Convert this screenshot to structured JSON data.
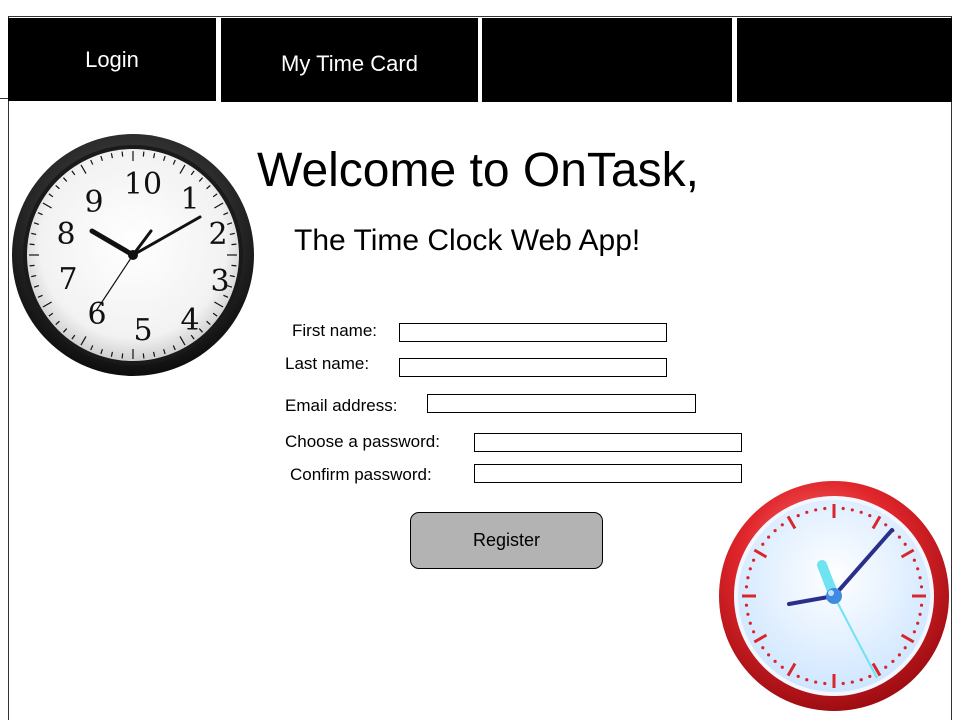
{
  "nav": {
    "tabs": [
      {
        "label": "Login"
      },
      {
        "label": "My Time Card"
      },
      {
        "label": ""
      },
      {
        "label": ""
      }
    ]
  },
  "header": {
    "title": "Welcome to OnTask,",
    "subtitle": "The Time Clock Web App!"
  },
  "form": {
    "first_name": {
      "label": "First name:",
      "value": ""
    },
    "last_name": {
      "label": "Last name:",
      "value": ""
    },
    "email": {
      "label": "Email address:",
      "value": ""
    },
    "password": {
      "label": "Choose a password:",
      "value": ""
    },
    "confirm_password": {
      "label": "Confirm password:",
      "value": ""
    },
    "register_label": "Register"
  },
  "icons": {
    "left_clock": "wall-clock-icon",
    "right_clock": "red-clock-icon"
  },
  "colors": {
    "nav_background": "#000000",
    "nav_text": "#ffffff",
    "button_background": "#b3b3b3",
    "red_clock_rim": "#d9262b",
    "red_clock_face": "#e8f4ff"
  }
}
